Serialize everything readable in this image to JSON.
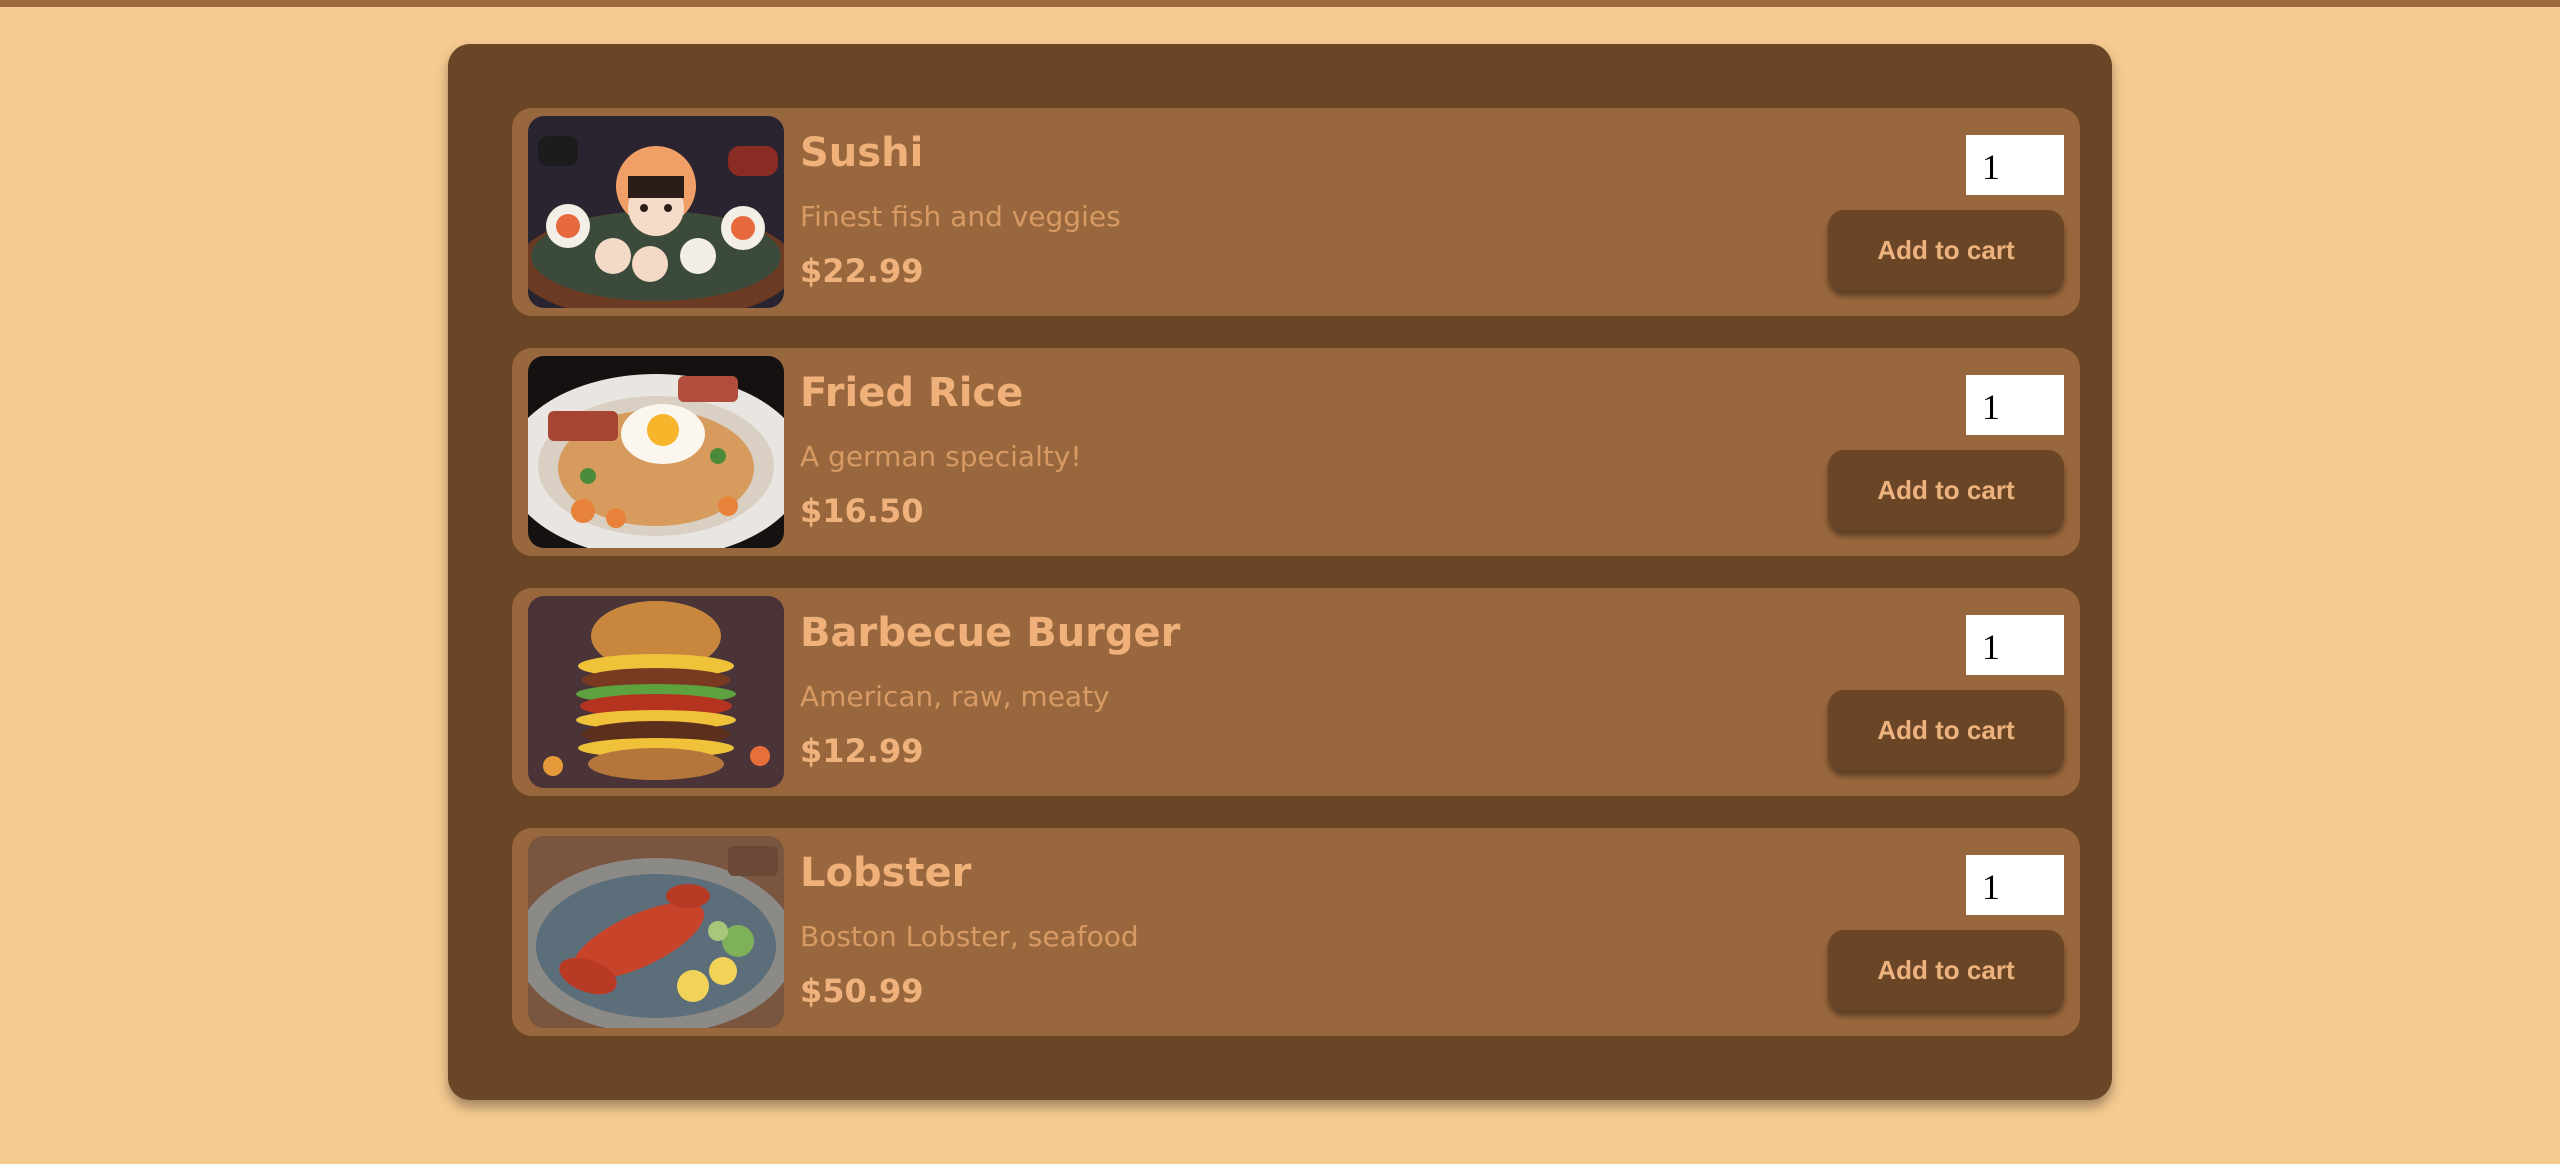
{
  "menu": {
    "items": [
      {
        "name": "Sushi",
        "description": "Finest fish and veggies",
        "price": "$22.99",
        "quantity": "1",
        "button_label": "Add to cart"
      },
      {
        "name": "Fried Rice",
        "description": "A german specialty!",
        "price": "$16.50",
        "quantity": "1",
        "button_label": "Add to cart"
      },
      {
        "name": "Barbecue Burger",
        "description": "American, raw, meaty",
        "price": "$12.99",
        "quantity": "1",
        "button_label": "Add to cart"
      },
      {
        "name": "Lobster",
        "description": "Boston Lobster, seafood",
        "price": "$50.99",
        "quantity": "1",
        "button_label": "Add to cart"
      }
    ]
  },
  "colors": {
    "page_background": "#f6cb92",
    "panel_background": "#6a4627",
    "card_background": "#99673d",
    "accent_text": "#f0b07a"
  }
}
